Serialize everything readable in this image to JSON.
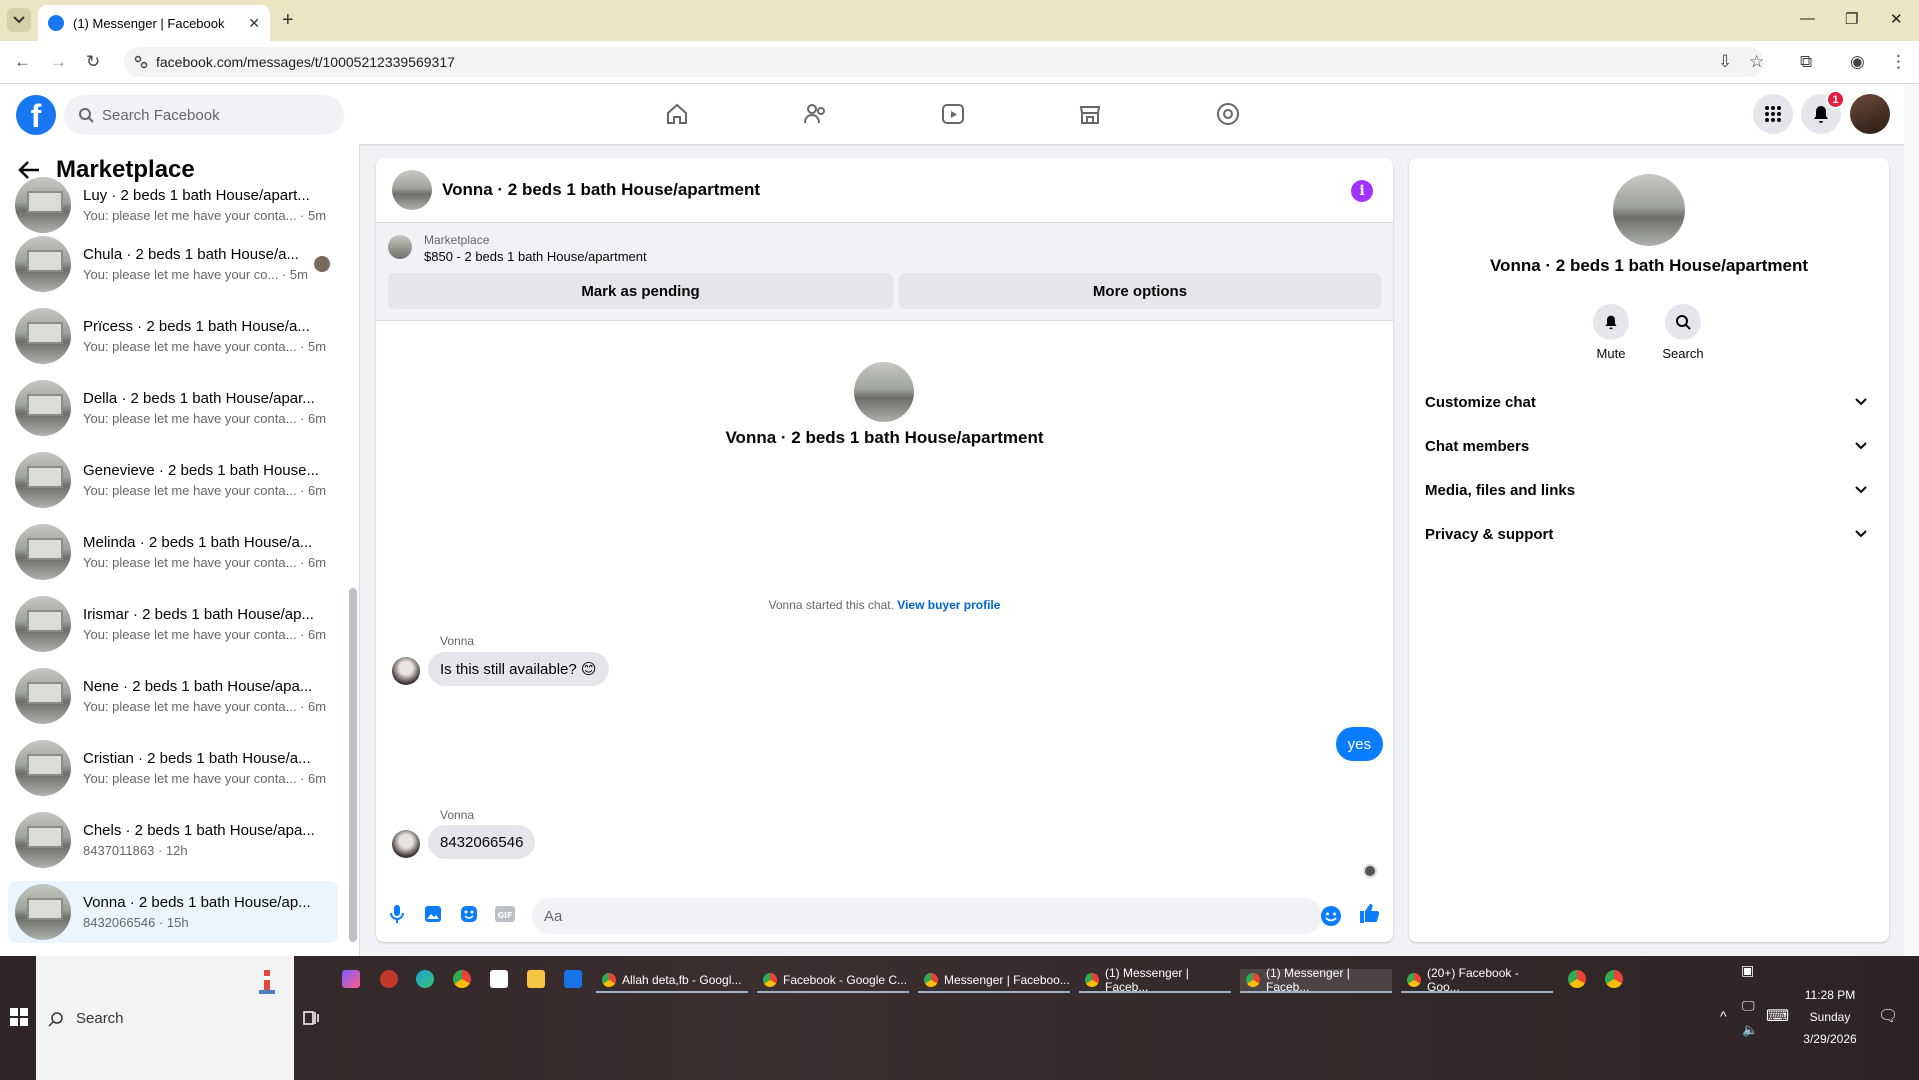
{
  "browser": {
    "tab_title": "(1) Messenger | Facebook",
    "url": "facebook.com/messages/t/10005212339569317"
  },
  "header": {
    "search_placeholder": "Search Facebook",
    "notifications_count": "1"
  },
  "sidebar": {
    "title": "Marketplace",
    "conversations": [
      {
        "name": "Luy · 2 beds 1 bath House/apart...",
        "preview": "You: please let me have your conta... · 5m"
      },
      {
        "name": "Chula · 2 beds 1 bath House/a...",
        "preview": "You: please let me have your co... · 5m"
      },
      {
        "name": "Prïcess · 2 beds 1 bath House/a...",
        "preview": "You: please let me have your conta... · 5m"
      },
      {
        "name": "Della · 2 beds 1 bath House/apar...",
        "preview": "You: please let me have your conta... · 6m"
      },
      {
        "name": "Genevieve · 2 beds 1 bath House...",
        "preview": "You: please let me have your conta... · 6m"
      },
      {
        "name": "Melinda · 2 beds 1 bath House/a...",
        "preview": "You: please let me have your conta... · 6m"
      },
      {
        "name": "Irismar · 2 beds 1 bath House/ap...",
        "preview": "You: please let me have your conta... · 6m"
      },
      {
        "name": "Nene · 2 beds 1 bath House/apa...",
        "preview": "You: please let me have your conta... · 6m"
      },
      {
        "name": "Cristian · 2 beds 1 bath House/a...",
        "preview": "You: please let me have your conta... · 6m"
      },
      {
        "name": "Chels · 2 beds 1 bath House/apa...",
        "preview": "8437011863 · 12h"
      },
      {
        "name": "Vonna · 2 beds 1 bath House/ap...",
        "preview": "8432066546 · 15h"
      }
    ]
  },
  "chat": {
    "title": "Vonna · 2 beds 1 bath House/apartment",
    "marketplace_label": "Marketplace",
    "listing": "$850 - 2 beds 1 bath House/apartment",
    "mark_pending": "Mark as pending",
    "more_options": "More options",
    "intro_name": "Vonna · 2 beds 1 bath House/apartment",
    "started_text": "Vonna started this chat.",
    "view_buyer_profile": "View buyer profile",
    "messages": [
      {
        "sender": "Vonna",
        "text": "Is this still available? 😊"
      },
      {
        "sender": "me",
        "text": "yes"
      },
      {
        "sender": "Vonna",
        "text": "8432066546"
      }
    ],
    "composer_placeholder": "Aa"
  },
  "info_panel": {
    "name": "Vonna · 2 beds 1 bath House/apartment",
    "mute": "Mute",
    "search": "Search",
    "sections": [
      "Customize chat",
      "Chat members",
      "Media, files and links",
      "Privacy & support"
    ]
  },
  "taskbar": {
    "search": "Search",
    "apps": [
      "Allah deta,fb - Googl...",
      "Facebook - Google C...",
      "Messenger | Faceboo...",
      "(1) Messenger | Faceb...",
      "(1) Messenger | Faceb...",
      "(20+) Facebook - Goo..."
    ],
    "time": "11:28 PM",
    "day": "Sunday",
    "date": "3/29/2026"
  }
}
